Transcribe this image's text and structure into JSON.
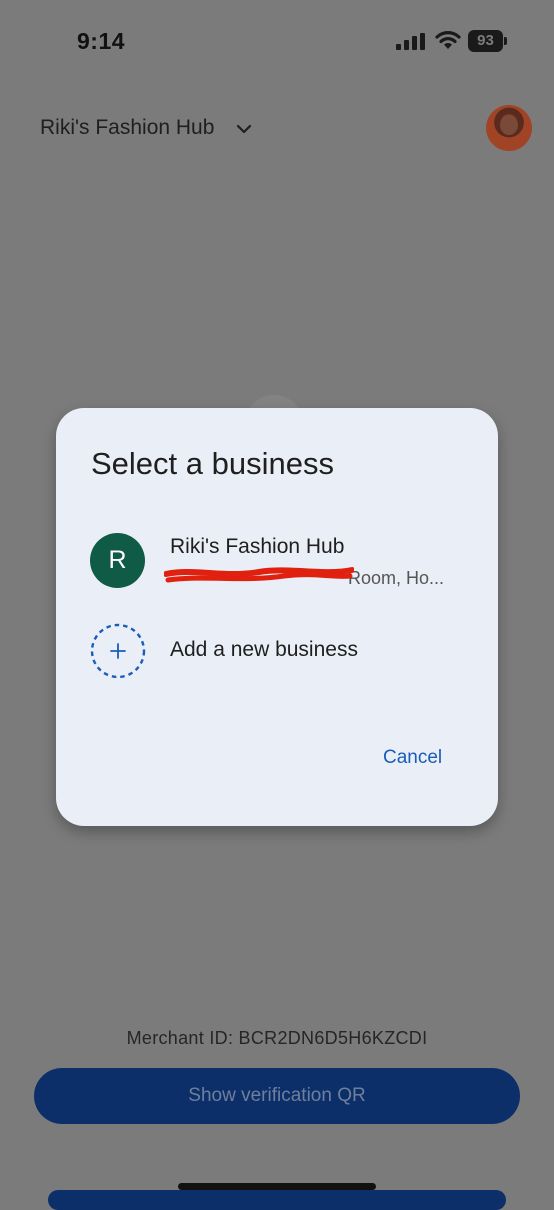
{
  "status_bar": {
    "time": "9:14",
    "battery": "93"
  },
  "header": {
    "business_name": "Riki's Fashion Hub"
  },
  "dialog": {
    "title": "Select a business",
    "business": {
      "initial": "R",
      "name": "Riki's Fashion Hub",
      "address_visible": "Room, Ho..."
    },
    "add_label": "Add a new business",
    "cancel_label": "Cancel"
  },
  "footer": {
    "merchant_id": "Merchant ID: BCR2DN6D5H6KZCDI",
    "qr_button": "Show verification QR"
  },
  "colors": {
    "accent": "#1a5cb8",
    "dialog_bg": "#eaeef6",
    "business_avatar": "#0f5b46",
    "primary_button": "#0c2f6a",
    "redaction": "#e0210f"
  },
  "icons": [
    "signal-icon",
    "wifi-icon",
    "battery-icon",
    "chevron-down-icon",
    "plus-icon"
  ]
}
